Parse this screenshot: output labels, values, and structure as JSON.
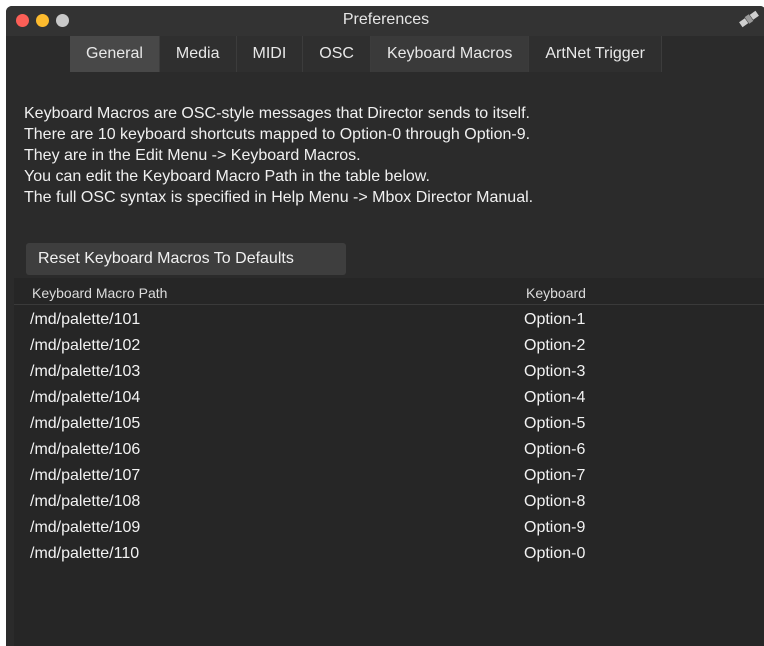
{
  "window": {
    "title": "Preferences"
  },
  "tabs": [
    {
      "label": "General",
      "state": "active"
    },
    {
      "label": "Media",
      "state": "normal"
    },
    {
      "label": "MIDI",
      "state": "normal"
    },
    {
      "label": "OSC",
      "state": "normal"
    },
    {
      "label": "Keyboard Macros",
      "state": "selected"
    },
    {
      "label": "ArtNet Trigger",
      "state": "normal"
    }
  ],
  "description": [
    "Keyboard Macros are OSC-style messages that Director sends to itself.",
    "There are 10 keyboard shortcuts mapped to Option-0 through Option-9.",
    "They are in the Edit Menu -> Keyboard Macros.",
    "You can edit the Keyboard Macro Path in the table below.",
    "The full OSC syntax is specified in Help Menu -> Mbox Director Manual."
  ],
  "reset_button": "Reset Keyboard Macros To Defaults",
  "table": {
    "columns": [
      "Keyboard Macro Path",
      "Keyboard"
    ],
    "rows": [
      {
        "path": "/md/palette/101",
        "key": "Option-1"
      },
      {
        "path": "/md/palette/102",
        "key": "Option-2"
      },
      {
        "path": "/md/palette/103",
        "key": "Option-3"
      },
      {
        "path": "/md/palette/104",
        "key": "Option-4"
      },
      {
        "path": "/md/palette/105",
        "key": "Option-5"
      },
      {
        "path": "/md/palette/106",
        "key": "Option-6"
      },
      {
        "path": "/md/palette/107",
        "key": "Option-7"
      },
      {
        "path": "/md/palette/108",
        "key": "Option-8"
      },
      {
        "path": "/md/palette/109",
        "key": "Option-9"
      },
      {
        "path": "/md/palette/110",
        "key": "Option-0"
      }
    ]
  },
  "colors": {
    "window_bg": "#2b2b2b",
    "close": "#fc5f57",
    "minimize": "#fdbb2e",
    "zoom": "#c9c9c9"
  },
  "icons": {
    "traffic_close": "close-button-icon",
    "traffic_minimize": "minimize-button-icon",
    "traffic_zoom": "zoom-button-icon",
    "corner": "satellite-icon"
  }
}
